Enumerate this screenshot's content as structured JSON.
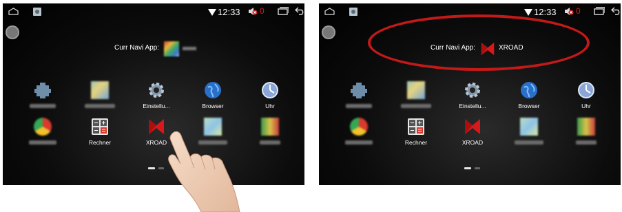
{
  "status_bar": {
    "time": "12:33",
    "volume_level": "0",
    "icons": [
      "home-icon",
      "gallery-icon",
      "wifi-icon",
      "volume-muted-icon",
      "recent-apps-icon",
      "back-icon"
    ]
  },
  "navi": {
    "label": "Curr Navi App:",
    "current_app_left": "",
    "current_app_right": "XROAD"
  },
  "apps": {
    "row1": [
      {
        "label": "",
        "icon": "settings-puzzle-icon"
      },
      {
        "label": "",
        "icon": "blurred-app-icon"
      },
      {
        "label": "Einstellu...",
        "icon": "gear-icon"
      },
      {
        "label": "Browser",
        "icon": "globe-icon"
      },
      {
        "label": "Uhr",
        "icon": "clock-icon"
      }
    ],
    "row2": [
      {
        "label": "",
        "icon": "chrome-like-icon"
      },
      {
        "label": "Rechner",
        "icon": "calculator-icon"
      },
      {
        "label": "XROAD",
        "icon": "xroad-icon"
      },
      {
        "label": "",
        "icon": "blurred-app-icon"
      },
      {
        "label": "",
        "icon": "blurred-app-icon"
      }
    ]
  },
  "page_indicator": {
    "pages": 2,
    "active": 1
  },
  "colors": {
    "highlight_ring": "#c21919",
    "xroad_red": "#d7191b",
    "mute_red": "#d21c1c"
  }
}
